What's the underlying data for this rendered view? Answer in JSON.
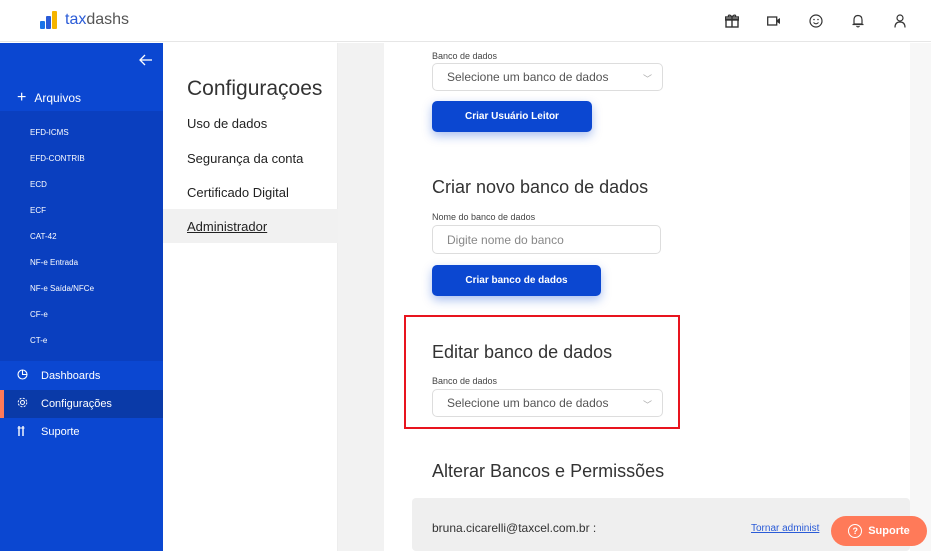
{
  "header": {
    "logo_prefix": "tax",
    "logo_suffix": "dashs",
    "icons": [
      "gift-icon",
      "video-icon",
      "smile-icon",
      "bell-icon",
      "user-icon"
    ]
  },
  "sidebar": {
    "back_icon": "arrow-left-icon",
    "arquivos_label": "Arquivos",
    "sub_items": [
      "EFD-ICMS",
      "EFD-CONTRIB",
      "ECD",
      "ECF",
      "CAT-42",
      "NF-e Entrada",
      "NF-e Saída/NFCe",
      "CF-e",
      "CT-e"
    ],
    "main_items": [
      {
        "label": "Dashboards",
        "icon": "pie-chart-icon"
      },
      {
        "label": "Configurações",
        "icon": "gear-icon"
      },
      {
        "label": "Suporte",
        "icon": "support-icon"
      }
    ]
  },
  "settings": {
    "title": "Configuraçoes",
    "items": [
      "Uso de dados",
      "Segurança da conta",
      "Certificado Digital",
      "Administrador"
    ],
    "active": "Administrador"
  },
  "main": {
    "top_select_label": "Banco de dados",
    "top_select_value": "Selecione um banco de dados",
    "criar_leitor_button": "Criar Usuário Leitor",
    "novo_heading": "Criar novo banco de dados",
    "nome_label": "Nome do banco de dados",
    "nome_placeholder": "Digite nome do banco",
    "criar_banco_button": "Criar banco de dados",
    "editar_heading": "Editar banco de dados",
    "editar_select_label": "Banco de dados",
    "editar_select_value": "Selecione um banco de dados",
    "permissoes_heading": "Alterar Bancos e Permissões",
    "perm_email": "bruna.cicarelli@taxcel.com.br :",
    "perm_link": "Tornar administ"
  },
  "floating": {
    "suporte_label": "Suporte"
  },
  "colors": {
    "primary": "#0b47d1",
    "accent": "#ff7a59",
    "highlight": "#e8141e"
  }
}
